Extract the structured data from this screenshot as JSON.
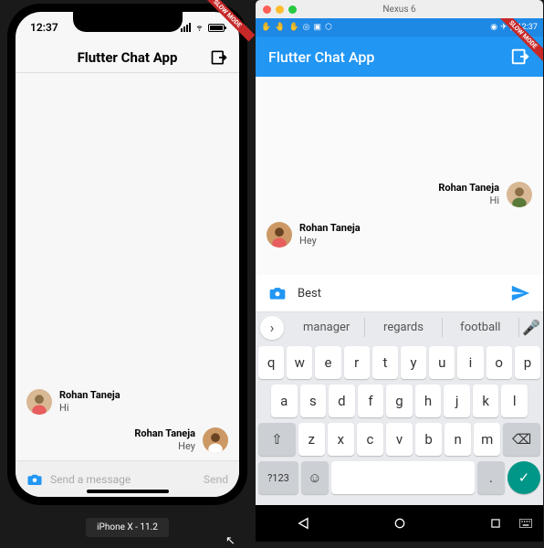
{
  "ios": {
    "time": "12:37",
    "title": "Flutter Chat App",
    "slow_mode": "SLOW MODE",
    "messages": [
      {
        "name": "Rohan Taneja",
        "body": "Hi"
      },
      {
        "name": "Rohan Taneja",
        "body": "Hey"
      }
    ],
    "input_placeholder": "Send a message",
    "send_label": "Send",
    "device_label": "iPhone X - 11.2"
  },
  "android": {
    "emulator_name": "Nexus 6",
    "time": "12:37",
    "title": "Flutter Chat App",
    "slow_mode": "SLOW MODE",
    "messages": [
      {
        "name": "Rohan Taneja",
        "body": "Hi"
      },
      {
        "name": "Rohan Taneja",
        "body": "Hey"
      }
    ],
    "input_value": "Best",
    "suggestions": [
      "manager",
      "regards",
      "football"
    ],
    "keyboard": {
      "row1": [
        "q",
        "w",
        "e",
        "r",
        "t",
        "y",
        "u",
        "i",
        "o",
        "p"
      ],
      "row2": [
        "a",
        "s",
        "d",
        "f",
        "g",
        "h",
        "j",
        "k",
        "l"
      ],
      "row3_shift": "⇧",
      "row3": [
        "z",
        "x",
        "c",
        "v",
        "b",
        "n",
        "m"
      ],
      "row3_del": "⌫",
      "row4_sym": "?123",
      "row4_emoji": "☺",
      "row4_go": "✓"
    }
  }
}
